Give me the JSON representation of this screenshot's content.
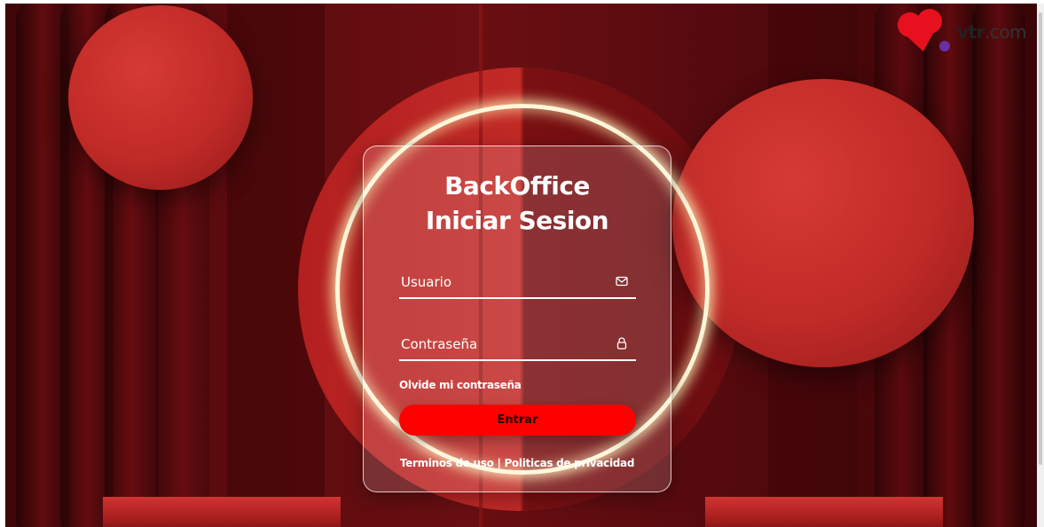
{
  "card": {
    "title_line1": "BackOffice",
    "title_line2": "Iniciar Sesion",
    "username": {
      "placeholder": "Usuario",
      "value": "",
      "icon": "mail-icon"
    },
    "password": {
      "placeholder": "Contraseña",
      "value": "",
      "icon": "lock-icon"
    },
    "forgot_label": "Olvide mi contraseña",
    "submit_label": "Entrar",
    "terms_label": "Terminos de uso",
    "separator": "|",
    "privacy_label": "Politicas de privacidad"
  },
  "logo": {
    "brand_bold": "vtr",
    "brand_rest": ".com"
  },
  "colors": {
    "accent": "#ff0000",
    "background": "#5a0b0e",
    "logo_red": "#e8101e",
    "logo_purple": "#6a2fa0"
  }
}
